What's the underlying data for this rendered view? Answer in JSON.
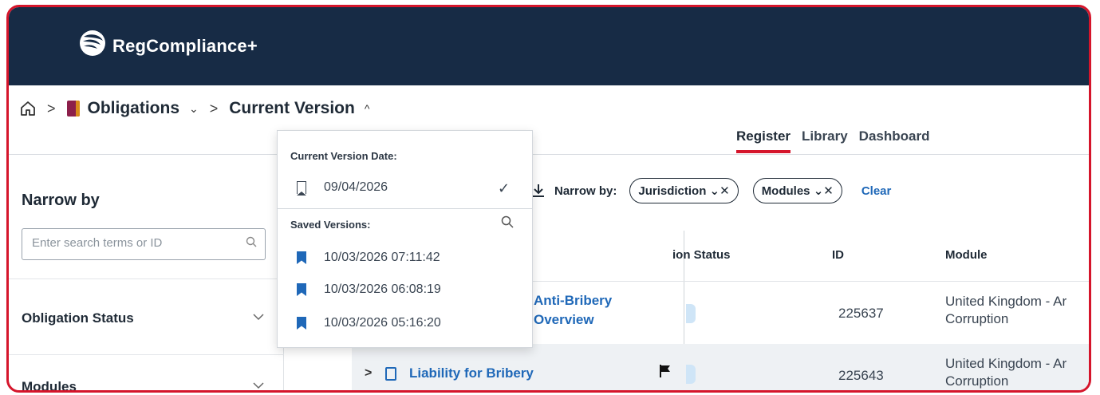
{
  "app": {
    "name": "RegCompliance+"
  },
  "breadcrumb": {
    "home_icon": "home-icon",
    "section": "Obligations",
    "current": "Current Version",
    "separator": ">",
    "section_chevron": "⌄",
    "current_chevron": "^"
  },
  "tabs": [
    {
      "label": "Register",
      "active": true
    },
    {
      "label": "Library",
      "active": false
    },
    {
      "label": "Dashboard",
      "active": false
    }
  ],
  "sidebar": {
    "title": "Narrow by",
    "search_placeholder": "Enter search terms or ID",
    "facets": [
      {
        "label": "Obligation Status"
      },
      {
        "label": "Modules"
      }
    ]
  },
  "filters": {
    "label": "Narrow by:",
    "chips": [
      {
        "label": "Jurisdiction ⌄✕"
      },
      {
        "label": "Modules ⌄✕"
      }
    ],
    "clear_label": "Clear"
  },
  "table": {
    "headers": {
      "status": "ion Status",
      "id": "ID",
      "module": "Module"
    },
    "rows": [
      {
        "title_line1": "Anti-Bribery",
        "title_line2": "Overview",
        "id": "225637",
        "module_line1": "United Kingdom - Ar",
        "module_line2": "Corruption"
      },
      {
        "title_line1": "Liability for Bribery",
        "id": "225643",
        "module_line1": "United Kingdom - Ar",
        "module_line2": "Corruption",
        "expand": ">"
      }
    ]
  },
  "version_dropdown": {
    "current_heading": "Current Version Date:",
    "current_date": "09/04/2026",
    "current_selected_mark": "✓",
    "saved_heading": "Saved Versions:",
    "saved": [
      {
        "label": "10/03/2026 07:11:42"
      },
      {
        "label": "10/03/2026 06:08:19"
      },
      {
        "label": "10/03/2026 05:16:20"
      }
    ]
  },
  "colors": {
    "topbar": "#172b45",
    "accent_red": "#d5152b",
    "link_blue": "#1f68b8"
  }
}
